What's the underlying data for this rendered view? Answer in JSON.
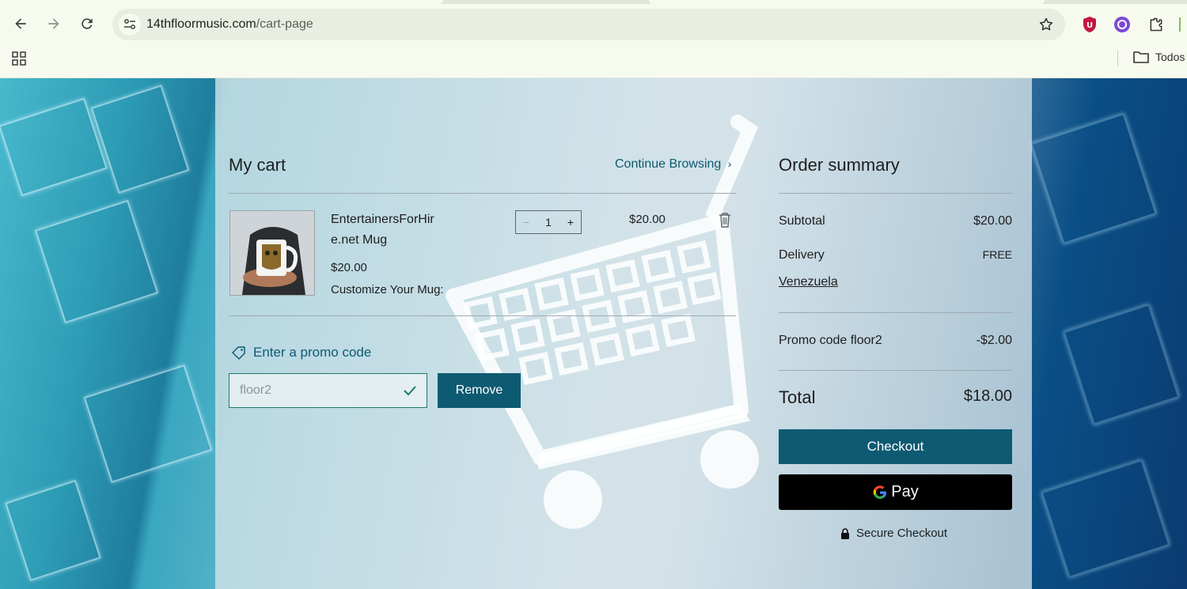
{
  "browser": {
    "url_domain": "14thfloormusic.com",
    "url_path": "/cart-page",
    "bookmark_folder": "Todos"
  },
  "cart": {
    "title": "My cart",
    "continue_link": "Continue Browsing",
    "item": {
      "name_line1": "EntertainersForHir",
      "name_line2": "e.net Mug",
      "unit_price": "$20.00",
      "option_label": "Customize Your Mug:",
      "quantity": "1",
      "total": "$20.00"
    },
    "promo_link": "Enter a promo code",
    "promo_value": "floor2",
    "remove_label": "Remove"
  },
  "summary": {
    "title": "Order summary",
    "subtotal_label": "Subtotal",
    "subtotal_value": "$20.00",
    "delivery_label": "Delivery",
    "delivery_value": "FREE",
    "delivery_country": "Venezuela",
    "promo_label": "Promo code floor2",
    "promo_value": "-$2.00",
    "total_label": "Total",
    "total_value": "$18.00",
    "checkout_label": "Checkout",
    "gpay_label": "Pay",
    "secure_label": "Secure Checkout"
  },
  "colors": {
    "accent": "#0e5a73",
    "gpay": "#000000"
  }
}
